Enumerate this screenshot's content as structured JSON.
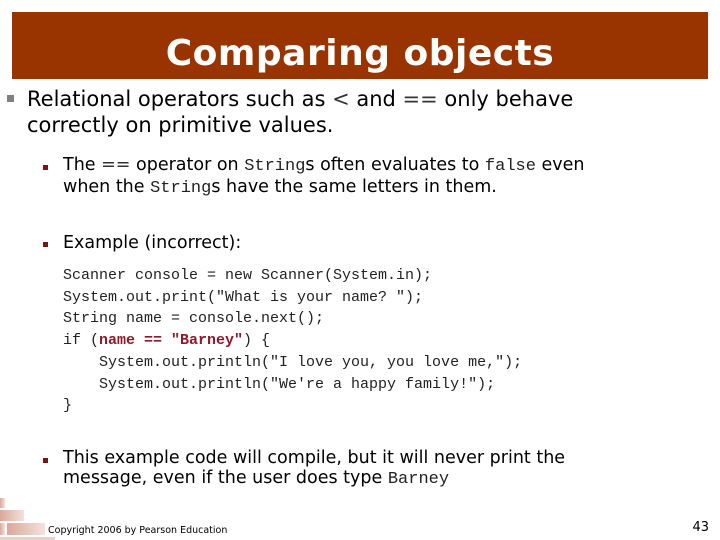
{
  "slide": {
    "title": "Comparing objects",
    "accent_color": "#993300",
    "bullets": [
      {
        "level": 1,
        "line1_a": "Relational operators such as ",
        "line1_op1": "<",
        "line1_b": " and ",
        "line1_op2": "==",
        "line1_c": " only behave",
        "line2": "correctly on primitive values."
      }
    ],
    "sub_bullets": [
      {
        "level": 2,
        "line1_a": "The ",
        "line1_op": "==",
        "line1_b": " operator on ",
        "line1_code1": "String",
        "line1_c": "s often evaluates to ",
        "line1_code2": "false",
        "line1_d": " even",
        "line2_a": "when the ",
        "line2_code": "String",
        "line2_b": "s have the same letters in them."
      },
      {
        "level": 2,
        "text": "Example (incorrect):"
      },
      {
        "level": 2,
        "line1": "This example code will compile, but it will never print the",
        "line2_a": "message, even if the user does type ",
        "line2_code": "Barney"
      }
    ],
    "code": {
      "line1": "Scanner console = new Scanner(System.in);",
      "line2": "System.out.print(\"What is your name? \");",
      "line3": "String name = console.next();",
      "line4_a": "if (",
      "line4_hl": "name == \"Barney\"",
      "line4_b": ") {",
      "line5": "    System.out.println(\"I love you, you love me,\");",
      "line6": "    System.out.println(\"We're a happy family!\");",
      "line7": "}"
    },
    "footer": {
      "copyright": "Copyright 2006 by Pearson Education",
      "page_number": "43",
      "decoration_icon": "brick-wall-icon"
    }
  }
}
